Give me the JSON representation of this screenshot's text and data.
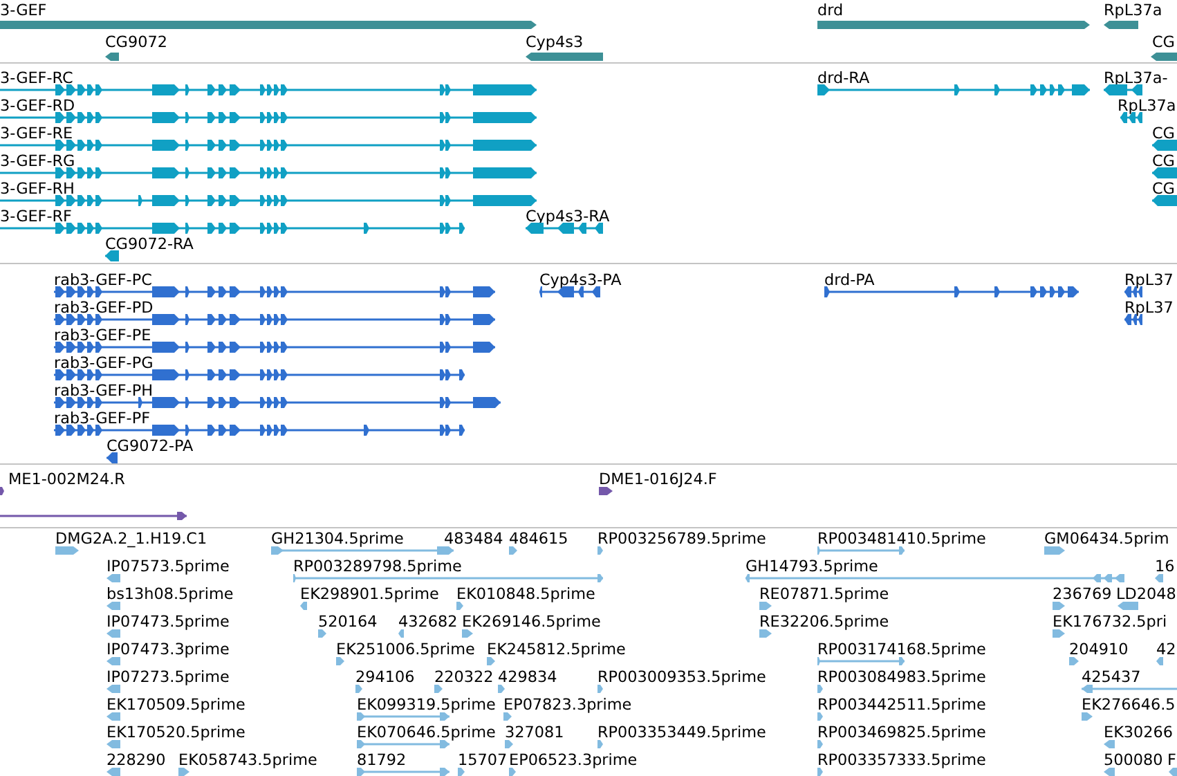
{
  "tracks": [
    {
      "kind": "gene",
      "features": [
        {
          "label": "3-GEF",
          "reverse": false
        },
        {
          "label": "CG9072",
          "reverse": true
        },
        {
          "label": "Cyp4s3",
          "reverse": true
        },
        {
          "label": "drd",
          "reverse": false
        },
        {
          "label": "RpL37a",
          "reverse": true
        },
        {
          "label": "CG",
          "reverse": true
        }
      ]
    },
    {
      "kind": "transcript",
      "features": [
        {
          "label": "3-GEF-RC",
          "reverse": false
        },
        {
          "label": "3-GEF-RD",
          "reverse": false
        },
        {
          "label": "3-GEF-RE",
          "reverse": false
        },
        {
          "label": "3-GEF-RG",
          "reverse": false
        },
        {
          "label": "3-GEF-RH",
          "reverse": false
        },
        {
          "label": "3-GEF-RF",
          "reverse": false
        },
        {
          "label": "CG9072-RA",
          "reverse": true
        },
        {
          "label": "Cyp4s3-RA",
          "reverse": true
        },
        {
          "label": "drd-RA",
          "reverse": false
        },
        {
          "label": "RpL37a-",
          "reverse": true
        },
        {
          "label": "RpL37a",
          "reverse": true
        },
        {
          "label": "CG",
          "reverse": true
        },
        {
          "label": "CG",
          "reverse": true
        },
        {
          "label": "CG",
          "reverse": true
        }
      ]
    },
    {
      "kind": "protein",
      "features": [
        {
          "label": "rab3-GEF-PC",
          "reverse": false
        },
        {
          "label": "rab3-GEF-PD",
          "reverse": false
        },
        {
          "label": "rab3-GEF-PE",
          "reverse": false
        },
        {
          "label": "rab3-GEF-PG",
          "reverse": false
        },
        {
          "label": "rab3-GEF-PH",
          "reverse": false
        },
        {
          "label": "rab3-GEF-PF",
          "reverse": false
        },
        {
          "label": "CG9072-PA",
          "reverse": true
        },
        {
          "label": "Cyp4s3-PA",
          "reverse": true
        },
        {
          "label": "drd-PA",
          "reverse": false
        },
        {
          "label": "RpL37",
          "reverse": true
        },
        {
          "label": "RpL37",
          "reverse": true
        }
      ]
    },
    {
      "kind": "clone_end",
      "features": [
        {
          "label": "ME1-002M24.R",
          "reverse": false
        },
        {
          "reverse": false
        },
        {
          "label": "DME1-016J24.F",
          "reverse": false
        }
      ]
    },
    {
      "kind": "est",
      "features": [
        {
          "label": "DMG2A.2_1.H19.C1",
          "reverse": false
        },
        {
          "label": "GH21304.5prime",
          "reverse": false
        },
        {
          "label": "483484",
          "reverse": false
        },
        {
          "label": "484615",
          "reverse": false
        },
        {
          "label": "RP003256789.5prime",
          "reverse": false
        },
        {
          "label": "RP003481410.5prime",
          "reverse": false
        },
        {
          "label": "GM06434.5prim",
          "reverse": false
        },
        {
          "label": "IP07573.5prime",
          "reverse": true
        },
        {
          "label": "RP003289798.5prime",
          "reverse": false
        },
        {
          "label": "GH14793.5prime",
          "reverse": true
        },
        {
          "label": "16",
          "reverse": true
        },
        {
          "label": "bs13h08.5prime",
          "reverse": true
        },
        {
          "label": "EK298901.5prime",
          "reverse": true
        },
        {
          "label": "EK010848.5prime",
          "reverse": false
        },
        {
          "label": "RE07871.5prime",
          "reverse": false
        },
        {
          "label": "236769",
          "reverse": false
        },
        {
          "label": "LD2048",
          "reverse": true
        },
        {
          "label": "IP07473.5prime",
          "reverse": true
        },
        {
          "label": "520164",
          "reverse": false
        },
        {
          "label": "432682",
          "reverse": true
        },
        {
          "label": "EK269146.5prime",
          "reverse": false
        },
        {
          "label": "RE32206.5prime",
          "reverse": false
        },
        {
          "label": "EK176732.5pri",
          "reverse": false
        },
        {
          "label": "IP07473.3prime",
          "reverse": true
        },
        {
          "label": "EK251006.5prime",
          "reverse": false
        },
        {
          "label": "EK245812.5prime",
          "reverse": false
        },
        {
          "label": "RP003174168.5prime",
          "reverse": false
        },
        {
          "label": "204910",
          "reverse": false
        },
        {
          "label": "42",
          "reverse": true
        },
        {
          "label": "IP07273.5prime",
          "reverse": true
        },
        {
          "label": "294106",
          "reverse": false
        },
        {
          "label": "220322",
          "reverse": false
        },
        {
          "label": "429834",
          "reverse": false
        },
        {
          "label": "RP003009353.5prime",
          "reverse": false
        },
        {
          "label": "RP003084983.5prime",
          "reverse": false
        },
        {
          "label": "425437",
          "reverse": true
        },
        {
          "label": "EK170509.5prime",
          "reverse": true
        },
        {
          "label": "EK099319.5prime",
          "reverse": false
        },
        {
          "label": "EP07823.3prime",
          "reverse": false
        },
        {
          "label": "RP003442511.5prime",
          "reverse": false
        },
        {
          "label": "EK276646.5",
          "reverse": false
        },
        {
          "label": "EK170520.5prime",
          "reverse": true
        },
        {
          "label": "EK070646.5prime",
          "reverse": false
        },
        {
          "label": "327081",
          "reverse": false
        },
        {
          "label": "RP003353449.5prime",
          "reverse": false
        },
        {
          "label": "RP003469825.5prime",
          "reverse": false
        },
        {
          "label": "EK30266",
          "reverse": true
        },
        {
          "label": "228290",
          "reverse": true
        },
        {
          "label": "EK058743.5prime",
          "reverse": false
        },
        {
          "label": "81792",
          "reverse": false
        },
        {
          "label": "15707",
          "reverse": false
        },
        {
          "label": "EP06523.3prime",
          "reverse": false
        },
        {
          "label": "RP003357333.5prime",
          "reverse": false
        },
        {
          "label": "500080",
          "reverse": true
        },
        {
          "label": "F",
          "reverse": true
        }
      ]
    }
  ]
}
